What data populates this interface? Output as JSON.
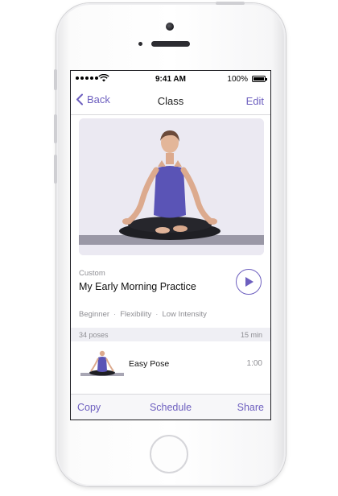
{
  "status_bar": {
    "time": "9:41 AM",
    "battery": "100%"
  },
  "navbar": {
    "back_label": "Back",
    "title": "Class",
    "edit_label": "Edit"
  },
  "class": {
    "type": "Custom",
    "name": "My Early Morning Practice",
    "tags": [
      "Beginner",
      "Flexibility",
      "Low Intensity"
    ]
  },
  "poses_header": {
    "count": "34 poses",
    "duration": "15 min"
  },
  "poses": [
    {
      "name": "Easy Pose",
      "time": "1:00"
    }
  ],
  "toolbar": {
    "copy_label": "Copy",
    "schedule_label": "Schedule",
    "share_label": "Share"
  },
  "colors": {
    "accent": "#6d5fbf",
    "muted": "#8e8e93",
    "header_bg": "#efeff4"
  },
  "icons": {
    "back": "chevron-left-icon",
    "play": "play-icon",
    "wifi": "wifi-icon",
    "battery": "battery-icon",
    "signal": "signal-icon"
  }
}
